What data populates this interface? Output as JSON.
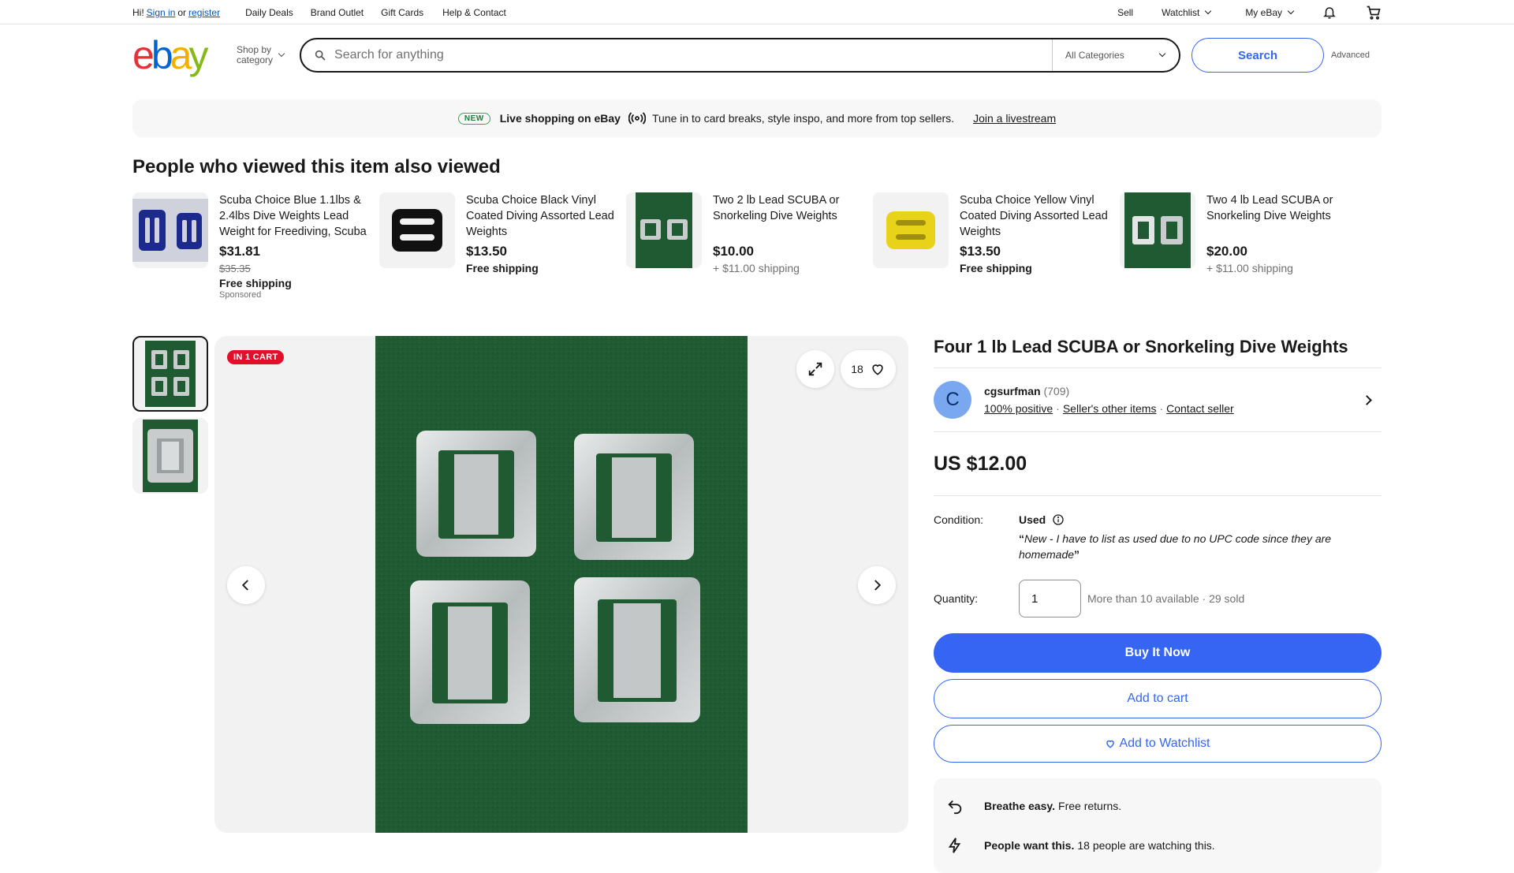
{
  "topbar": {
    "greeting": "Hi!",
    "sign_in": "Sign in",
    "or": "or",
    "register": "register",
    "nav": [
      "Daily Deals",
      "Brand Outlet",
      "Gift Cards",
      "Help & Contact"
    ],
    "sell": "Sell",
    "watchlist": "Watchlist",
    "my_ebay": "My eBay"
  },
  "header": {
    "logo_letters": [
      "e",
      "b",
      "a",
      "y"
    ],
    "logo_colors": [
      "#e53238",
      "#0064d2",
      "#f5af02",
      "#86b817"
    ],
    "shop_by": "Shop by",
    "category": "category",
    "search_placeholder": "Search for anything",
    "all_categories": "All Categories",
    "search_button": "Search",
    "advanced": "Advanced"
  },
  "banner": {
    "badge": "NEW",
    "title": "Live shopping on eBay",
    "text": "Tune in to card breaks, style inspo, and more from top sellers.",
    "link": "Join a livestream"
  },
  "also_viewed": {
    "title": "People who viewed this item also viewed",
    "items": [
      {
        "title": "Scuba Choice Blue 1.1lbs & 2.4lbs Dive Weights Lead Weight for Freediving, Scuba",
        "price": "$31.81",
        "orig": "$35.35",
        "shipping": "Free shipping",
        "sponsored": "Sponsored",
        "color": "#1b2a8c"
      },
      {
        "title": "Scuba Choice Black Vinyl Coated Diving Assorted Lead Weights",
        "price": "$13.50",
        "orig": "",
        "shipping": "Free shipping",
        "sponsored": "",
        "color": "#111111"
      },
      {
        "title": "Two 2 lb Lead SCUBA or Snorkeling Dive Weights",
        "price": "$10.00",
        "orig": "",
        "shipping": "+ $11.00 shipping",
        "sponsored": "",
        "color": "#1f5a32"
      },
      {
        "title": "Scuba Choice Yellow Vinyl Coated Diving Assorted Lead Weights",
        "price": "$13.50",
        "orig": "",
        "shipping": "Free shipping",
        "sponsored": "",
        "color": "#e8d31a"
      },
      {
        "title": "Two 4 lb Lead SCUBA or Snorkeling Dive Weights",
        "price": "$20.00",
        "orig": "",
        "shipping": "+ $11.00 shipping",
        "sponsored": "",
        "color": "#1f5a32"
      }
    ]
  },
  "gallery": {
    "in_cart": "IN 1 CART",
    "watch_count": "18"
  },
  "product": {
    "title": "Four 1 lb Lead SCUBA or Snorkeling Dive Weights",
    "seller_initial": "C",
    "seller_name": "cgsurfman",
    "seller_score": "(709)",
    "positive": "100% positive",
    "other_items": "Seller's other items",
    "contact": "Contact seller",
    "price": "US $12.00",
    "condition_label": "Condition:",
    "condition": "Used",
    "condition_desc_open": "“",
    "condition_desc": "New - I have to list as used due to no UPC code since they are homemade",
    "condition_desc_close": "”",
    "quantity_label": "Quantity:",
    "quantity": "1",
    "availability": "More than 10 available · 29 sold",
    "buy_now": "Buy It Now",
    "add_to_cart": "Add to cart",
    "add_to_watchlist": "Add to Watchlist",
    "perk1_bold": "Breathe easy.",
    "perk1_text": "Free returns.",
    "perk2_bold": "People want this.",
    "perk2_text": "18 people are watching this."
  },
  "colors": {
    "accent": "#3665f3",
    "cart_badge": "#e0102a",
    "green_felt": "#1f5a32"
  }
}
